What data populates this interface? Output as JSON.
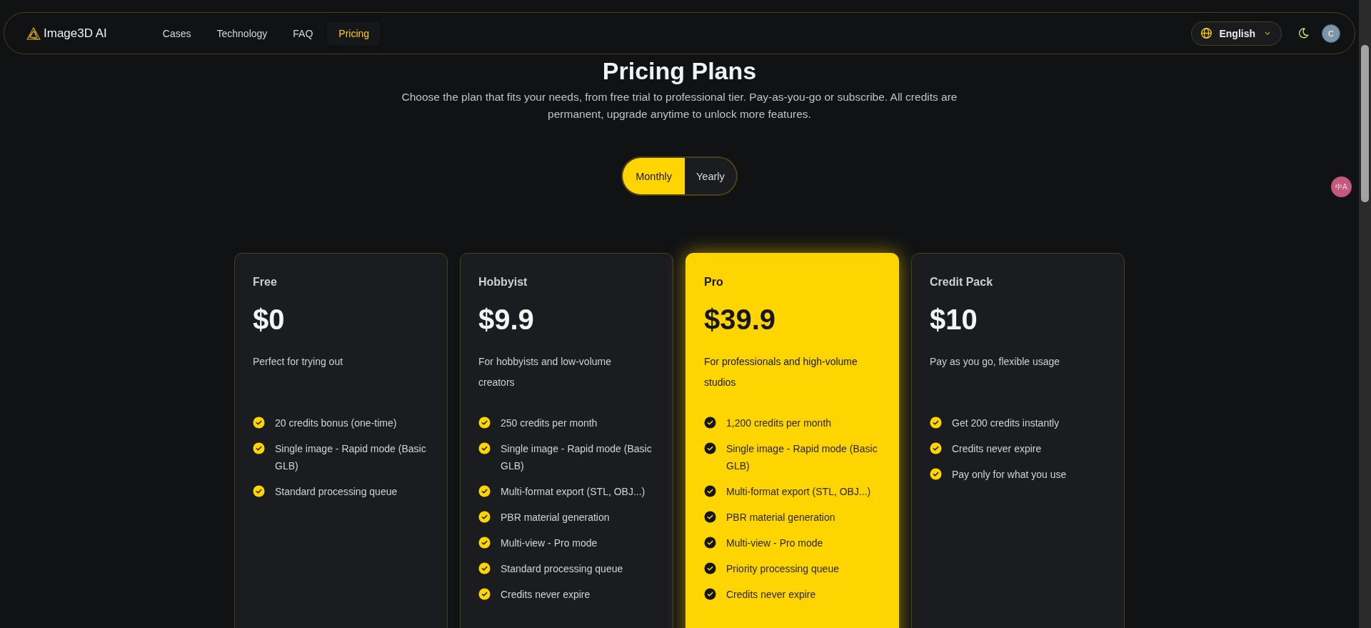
{
  "header": {
    "logo": "Image3D AI",
    "nav": [
      {
        "label": "Cases",
        "selected": false
      },
      {
        "label": "Technology",
        "selected": false
      },
      {
        "label": "FAQ",
        "selected": false
      },
      {
        "label": "Pricing",
        "selected": true
      }
    ],
    "language": "English",
    "avatar": "C"
  },
  "title": "Pricing Plans",
  "subtitle": "Choose the plan that fits your needs, from free trial to professional tier. Pay-as-you-go or subscribe. All credits are permanent, upgrade anytime to unlock more features.",
  "billing": [
    {
      "label": "Monthly",
      "selected": true
    },
    {
      "label": "Yearly",
      "selected": false
    }
  ],
  "plans": [
    {
      "name": "Free",
      "price": "$0",
      "description": "Perfect for trying out",
      "featured": false,
      "features": [
        "20 credits bonus (one-time)",
        "Single image - Rapid mode (Basic GLB)",
        "Standard processing queue"
      ]
    },
    {
      "name": "Hobbyist",
      "price": "$9.9",
      "description": "For hobbyists and low-volume creators",
      "featured": false,
      "features": [
        "250 credits per month",
        "Single image - Rapid mode (Basic GLB)",
        "Multi-format export (STL, OBJ...)",
        "PBR material generation",
        "Multi-view - Pro mode",
        "Standard processing queue",
        "Credits never expire"
      ]
    },
    {
      "name": "Pro",
      "price": "$39.9",
      "description": "For professionals and high-volume studios",
      "featured": true,
      "features": [
        "1,200 credits per month",
        "Single image - Rapid mode (Basic GLB)",
        "Multi-format export (STL, OBJ...)",
        "PBR material generation",
        "Multi-view - Pro mode",
        "Priority processing queue",
        "Credits never expire"
      ]
    },
    {
      "name": "Credit Pack",
      "price": "$10",
      "description": "Pay as you go, flexible usage",
      "featured": false,
      "features": [
        "Get 200 credits instantly",
        "Credits never expire",
        "Pay only for what you use"
      ]
    }
  ],
  "translate_button": "中A"
}
